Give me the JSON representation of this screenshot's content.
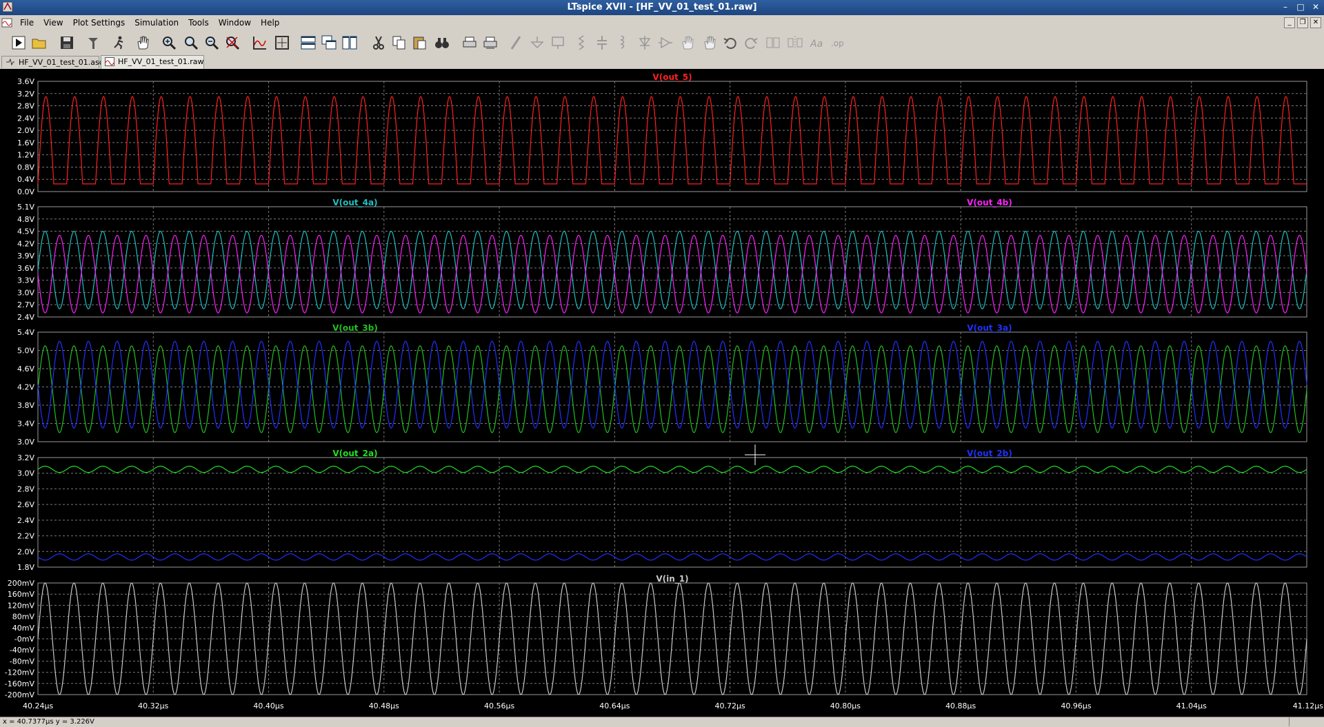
{
  "window": {
    "title": "LTspice XVII - [HF_VV_01_test_01.raw]",
    "controls": [
      "minimize",
      "maximize",
      "close"
    ]
  },
  "menu": {
    "items": [
      {
        "label": "File"
      },
      {
        "label": "View"
      },
      {
        "label": "Plot Settings"
      },
      {
        "label": "Simulation"
      },
      {
        "label": "Tools"
      },
      {
        "label": "Window"
      },
      {
        "label": "Help"
      }
    ]
  },
  "toolbar": {
    "buttons": [
      "run-icon",
      "open-folder-icon",
      "save-icon",
      "control-panel-icon",
      "halt-icon",
      "pan-icon",
      "zoom-in-icon",
      "zoom-out-icon",
      "zoom-back-icon",
      "zoom-cancel-icon",
      "autorange-icon",
      "marker-icon",
      "tile-horizontal-icon",
      "cascade-icon",
      "tile-vertical-icon",
      "cut-icon",
      "copy-icon",
      "paste-icon",
      "find-icon",
      "print-icon",
      "print-setup-icon",
      "wire-icon",
      "ground-icon",
      "label-icon",
      "resistor-icon",
      "capacitor-icon",
      "inductor-icon",
      "diode-icon",
      "component-icon",
      "move-icon",
      "drag-icon",
      "undo-icon",
      "redo-icon",
      "rotate-icon",
      "mirror-icon",
      "text-icon",
      "spice-directive-icon"
    ]
  },
  "tabs": [
    {
      "label": "HF_VV_01_test_01.asc",
      "active": false
    },
    {
      "label": "HF_VV_01_test_01.raw",
      "active": true
    }
  ],
  "status": {
    "cursor_readout": "x = 40.7377µs    y = 3.226V"
  },
  "colors": {
    "background": "#000000",
    "grid": "#7a7a7a",
    "out_5": "#ff2020",
    "out_4a": "#20c0c0",
    "out_4b": "#ff20ff",
    "out_3b": "#20c020",
    "out_3a": "#2030ff",
    "out_2a": "#20e020",
    "out_2b": "#2030ff",
    "in_1": "#c8c8c8"
  },
  "chart_data": [
    {
      "type": "line",
      "xlim": [
        40.24,
        41.12
      ],
      "x_unit": "µs",
      "x_ticks": [
        "40.24µs",
        "40.32µs",
        "40.40µs",
        "40.48µs",
        "40.56µs",
        "40.64µs",
        "40.72µs",
        "40.80µs",
        "40.88µs",
        "40.96µs",
        "41.04µs",
        "41.12µs"
      ],
      "ylim": [
        0.0,
        3.6
      ],
      "y_ticks": [
        "3.6V",
        "3.2V",
        "2.8V",
        "2.4V",
        "2.0V",
        "1.6V",
        "1.2V",
        "0.8V",
        "0.4V",
        "0.0V"
      ],
      "grid": true,
      "series": [
        {
          "name": "V(out_5)",
          "color": "#ff2020",
          "shape": "clipped-pulse",
          "period_us": 0.02,
          "low": 0.25,
          "high": 3.1,
          "duty": 0.55,
          "phase_us": 0.0
        }
      ]
    },
    {
      "type": "line",
      "xlim": [
        40.24,
        41.12
      ],
      "x_unit": "µs",
      "ylim": [
        2.4,
        5.1
      ],
      "y_ticks": [
        "5.1V",
        "4.8V",
        "4.5V",
        "4.2V",
        "3.9V",
        "3.6V",
        "3.3V",
        "3.0V",
        "2.7V",
        "2.4V"
      ],
      "grid": true,
      "series": [
        {
          "name": "V(out_4a)",
          "color": "#20c0c0",
          "shape": "sine",
          "period_us": 0.02,
          "offset": 3.55,
          "amplitude": 0.95,
          "phase": 0.0
        },
        {
          "name": "V(out_4b)",
          "color": "#ff20ff",
          "shape": "sine",
          "period_us": 0.02,
          "offset": 3.45,
          "amplitude": 0.95,
          "phase": 3.14159
        }
      ]
    },
    {
      "type": "line",
      "xlim": [
        40.24,
        41.12
      ],
      "x_unit": "µs",
      "ylim": [
        3.0,
        5.4
      ],
      "y_ticks": [
        "5.4V",
        "5.0V",
        "4.6V",
        "4.2V",
        "3.8V",
        "3.4V",
        "3.0V"
      ],
      "grid": true,
      "series": [
        {
          "name": "V(out_3b)",
          "color": "#20c020",
          "shape": "sine",
          "period_us": 0.02,
          "offset": 4.15,
          "amplitude": 0.95,
          "phase": 0.0
        },
        {
          "name": "V(out_3a)",
          "color": "#2030ff",
          "shape": "sine",
          "period_us": 0.02,
          "offset": 4.25,
          "amplitude": 0.95,
          "phase": 3.14159
        }
      ]
    },
    {
      "type": "line",
      "xlim": [
        40.24,
        41.12
      ],
      "x_unit": "µs",
      "ylim": [
        1.8,
        3.2
      ],
      "y_ticks": [
        "3.2V",
        "3.0V",
        "2.8V",
        "2.6V",
        "2.4V",
        "2.2V",
        "2.0V",
        "1.8V"
      ],
      "grid": true,
      "series": [
        {
          "name": "V(out_2a)",
          "color": "#20e020",
          "shape": "sine",
          "period_us": 0.02,
          "offset": 3.05,
          "amplitude": 0.04,
          "phase": 0.0
        },
        {
          "name": "V(out_2b)",
          "color": "#2030ff",
          "shape": "sine",
          "period_us": 0.02,
          "offset": 1.93,
          "amplitude": 0.04,
          "phase": 3.14159
        }
      ]
    },
    {
      "type": "line",
      "xlim": [
        40.24,
        41.12
      ],
      "x_unit": "µs",
      "ylim": [
        -200,
        200
      ],
      "y_unit": "mV",
      "y_ticks": [
        "200mV",
        "160mV",
        "120mV",
        "80mV",
        "40mV",
        "-0mV",
        "-40mV",
        "-80mV",
        "-120mV",
        "-160mV",
        "-200mV"
      ],
      "grid": true,
      "series": [
        {
          "name": "V(in_1)",
          "color": "#c8c8c8",
          "shape": "sine",
          "period_us": 0.02,
          "offset": 0,
          "amplitude": 200,
          "phase": 0.0
        }
      ]
    }
  ]
}
